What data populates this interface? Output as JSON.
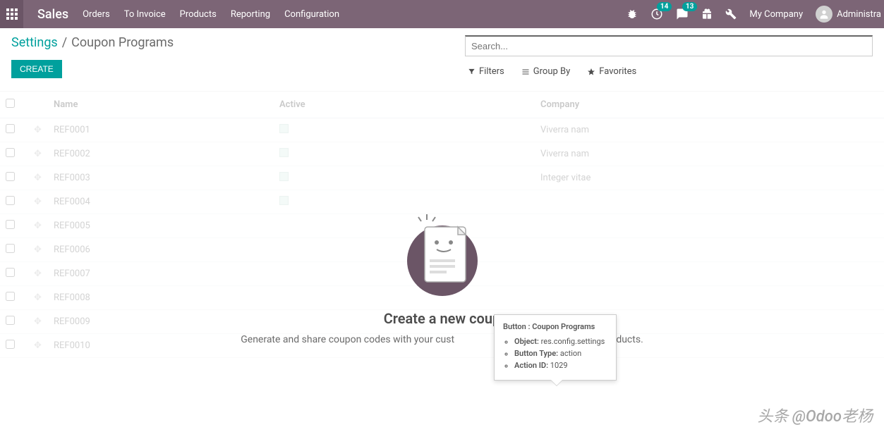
{
  "topbar": {
    "app_name": "Sales",
    "menu": [
      "Orders",
      "To Invoice",
      "Products",
      "Reporting",
      "Configuration"
    ],
    "activities_badge": "14",
    "discuss_badge": "13",
    "company": "My Company",
    "user": "Administra"
  },
  "breadcrumb": {
    "parent": "Settings",
    "current": "Coupon Programs"
  },
  "buttons": {
    "create": "CREATE"
  },
  "search": {
    "placeholder": "Search...",
    "filters": "Filters",
    "group_by": "Group By",
    "favorites": "Favorites"
  },
  "columns": {
    "name": "Name",
    "active": "Active",
    "company": "Company"
  },
  "rows": [
    {
      "name": "REF0001",
      "active": true,
      "company": "Viverra nam"
    },
    {
      "name": "REF0002",
      "active": true,
      "company": "Viverra nam"
    },
    {
      "name": "REF0003",
      "active": true,
      "company": "Integer vitae"
    },
    {
      "name": "REF0004",
      "active": true,
      "company": ""
    },
    {
      "name": "REF0005",
      "active": false,
      "company": ""
    },
    {
      "name": "REF0006",
      "active": false,
      "company": ""
    },
    {
      "name": "REF0007",
      "active": false,
      "company": ""
    },
    {
      "name": "REF0008",
      "active": false,
      "company": ""
    },
    {
      "name": "REF0009",
      "active": false,
      "company": ""
    },
    {
      "name": "REF0010",
      "active": false,
      "company": ""
    }
  ],
  "empty": {
    "title": "Create a new coup",
    "subtitle_left": "Generate and share coupon codes with your cust",
    "subtitle_right": "free products."
  },
  "tooltip": {
    "title": "Button : Coupon Programs",
    "object_label": "Object:",
    "object_value": "res.config.settings",
    "button_type_label": "Button Type:",
    "button_type_value": "action",
    "action_id_label": "Action ID:",
    "action_id_value": "1029"
  },
  "watermark": "头条 @Odoo老杨"
}
